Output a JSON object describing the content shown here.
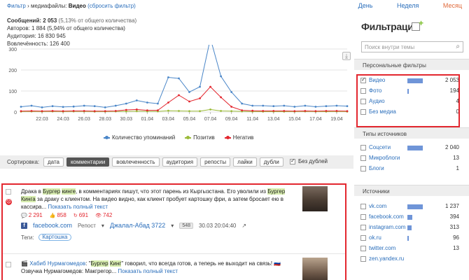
{
  "breadcrumb": {
    "prefix": "Фильтр",
    "sep": "›",
    "media_label": "медиафайлы:",
    "media_value": "Видео",
    "reset_link": "(сбросить фильтр)"
  },
  "periods": [
    {
      "label": "День",
      "active": false
    },
    {
      "label": "Неделя",
      "active": false
    },
    {
      "label": "Месяц",
      "active": true
    }
  ],
  "stats": {
    "messages_label": "Сообщений:",
    "messages_value": "2 053",
    "messages_share": "(5,13% от общего количества)",
    "authors": "Авторов: 1 884 (5,94% от общего количества)",
    "audience": "Аудитория: 16 830 945",
    "engagement": "Вовлечённость: 126 400"
  },
  "chart_data": {
    "type": "line",
    "x": [
      "20.03",
      "21.03",
      "22.03",
      "23.03",
      "24.03",
      "25.03",
      "26.03",
      "27.03",
      "28.03",
      "29.03",
      "30.03",
      "31.03",
      "01.04",
      "02.04",
      "03.04",
      "04.04",
      "05.04",
      "06.04",
      "07.04",
      "08.04",
      "09.04",
      "10.04",
      "11.04",
      "12.04",
      "13.04",
      "14.04",
      "15.04",
      "16.04",
      "17.04",
      "18.04",
      "19.04",
      "20.04"
    ],
    "tick_labels": [
      "22.03",
      "24.03",
      "26.03",
      "28.03",
      "30.03",
      "01.04",
      "03.04",
      "05.04",
      "07.04",
      "09.04",
      "11.04",
      "13.04",
      "15.04",
      "17.04",
      "19.04"
    ],
    "ylim": [
      0,
      300
    ],
    "yticks": [
      0,
      100,
      200,
      300
    ],
    "series": [
      {
        "name": "Количество упоминаний",
        "color": "#4a86c8",
        "values": [
          25,
          30,
          22,
          28,
          24,
          26,
          30,
          28,
          22,
          30,
          40,
          55,
          45,
          40,
          165,
          160,
          95,
          120,
          350,
          170,
          95,
          40,
          30,
          30,
          28,
          30,
          25,
          30,
          25,
          28,
          30,
          28
        ]
      },
      {
        "name": "Позитив",
        "color": "#9bbb3a",
        "values": [
          2,
          3,
          2,
          3,
          2,
          3,
          3,
          2,
          2,
          3,
          3,
          4,
          3,
          3,
          6,
          5,
          4,
          4,
          12,
          5,
          4,
          3,
          2,
          2,
          2,
          2,
          2,
          3,
          2,
          2,
          3,
          2
        ]
      },
      {
        "name": "Негатив",
        "color": "#e3272f",
        "values": [
          4,
          5,
          4,
          5,
          4,
          5,
          5,
          4,
          4,
          5,
          10,
          12,
          8,
          8,
          45,
          80,
          50,
          65,
          120,
          70,
          25,
          8,
          6,
          5,
          5,
          5,
          4,
          5,
          4,
          5,
          5,
          4
        ]
      }
    ],
    "grid": true
  },
  "sort": {
    "label": "Сортировка:",
    "options": [
      {
        "label": "дата",
        "active": false
      },
      {
        "label": "комментарии",
        "active": true
      },
      {
        "label": "вовлеченность",
        "active": false
      },
      {
        "label": "аудитория",
        "active": false
      },
      {
        "label": "репосты",
        "active": false
      },
      {
        "label": "лайки",
        "active": false
      },
      {
        "label": "дубли",
        "active": false
      }
    ],
    "no_duplicates": "Без дублей"
  },
  "posts": [
    {
      "text_a": "Драка в ",
      "hl1": "Бургер",
      "text_b": " ",
      "hl2": "кинге",
      "text_c": ", в комментариях пишут, что этот парень из Кыргызстана. Его уволили из ",
      "hl3": "Бургер",
      "text_d": " ",
      "hl4": "Кинга",
      "text_e": " за драку с клиентом. На видео видно, как клиент пробует картошку фри, а затем бросает ею в кассира...",
      "show_full": "Показать полный текст",
      "metrics": {
        "comments": "2 291",
        "likes": "858",
        "reposts": "691",
        "views": "742"
      },
      "source": "facebook.com",
      "repost": "Репост",
      "author": "Джалал-Абад 3722",
      "reach": "548",
      "datetime": "30.03 20:04:40",
      "tags_label": "Теги:",
      "tag": "Картошка"
    },
    {
      "prefix": "🎬 ",
      "author_link": "Хабиб Нурмагомедов",
      "text_a": ": \"",
      "hl1": "Бургер",
      "text_b": " ",
      "hl2": "Кинг",
      "text_c": "\" говорил, что всегда готов, а теперь не выходит на связь! 🇷🇺",
      "line2": "Озвучка Нурмагомедов: Макгрегор...",
      "show_full": "Показать полный текст"
    }
  ],
  "sidebar": {
    "title": "Фильтрация",
    "search_placeholder": "Поиск внутри темы",
    "personal_title": "Персональные фильтры",
    "personal": [
      {
        "name": "Видео",
        "count": "2 053",
        "checked": true,
        "share": 1.0
      },
      {
        "name": "Фото",
        "count": "194",
        "checked": false,
        "share": 0.09
      },
      {
        "name": "Аудио",
        "count": "4",
        "checked": false,
        "share": 0.0
      },
      {
        "name": "Без медиа",
        "count": "0",
        "checked": false,
        "share": 0.0
      }
    ],
    "types_title": "Типы источников",
    "types": [
      {
        "name": "Соцсети",
        "count": "2 040",
        "share": 1.0
      },
      {
        "name": "Микроблоги",
        "count": "13",
        "share": 0.01
      },
      {
        "name": "Блоги",
        "count": "1",
        "share": 0.0
      }
    ],
    "sources_title": "Источники",
    "sources": [
      {
        "name": "vk.com",
        "count": "1 237",
        "share": 1.0
      },
      {
        "name": "facebook.com",
        "count": "394",
        "share": 0.32
      },
      {
        "name": "instagram.com",
        "count": "313",
        "share": 0.25
      },
      {
        "name": "ok.ru",
        "count": "96",
        "share": 0.08
      },
      {
        "name": "twitter.com",
        "count": "13",
        "share": 0.01
      },
      {
        "name": "zen.yandex.ru",
        "count": "",
        "share": 0.0
      }
    ]
  },
  "colors": {
    "accent": "#2a6ebb",
    "active_period": "#e06a3b",
    "highlight": "#d9efb0",
    "alert": "#e3272f",
    "bar": "#6f95d8"
  }
}
